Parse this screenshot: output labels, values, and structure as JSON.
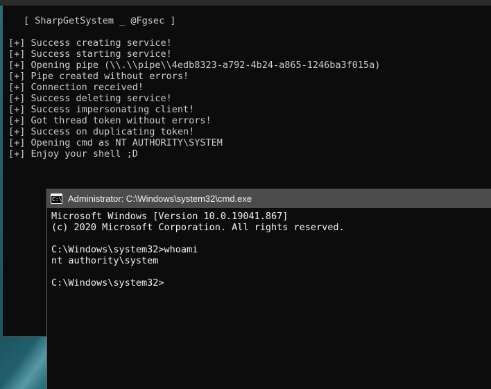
{
  "desktop": {
    "wallpaper_color": "#1d5563"
  },
  "top_strip": {
    "color": "#2b2b2c"
  },
  "sharp_window": {
    "name": "SharpGetSystem console",
    "background_color": "#0c0c0c",
    "text_color": "#cccccc",
    "banner": "[ SharpGetSystem _ @Fgsec ]",
    "lines": [
      "[+] Success creating service!",
      "[+] Success starting service!",
      "[+] Opening pipe (\\\\.\\\\pipe\\\\4edb8323-a792-4b24-a865-1246ba3f015a)",
      "[+] Pipe created without errors!",
      "[+] Connection received!",
      "[+] Success deleting service!",
      "[+] Success impersonating client!",
      "[+] Got thread token without errors!",
      "[+] Success on duplicating token!",
      "[+] Opening cmd as NT AUTHORITY\\SYSTEM",
      "[+] Enjoy your shell ;D"
    ]
  },
  "cmd_window": {
    "name": "Administrator cmd.exe",
    "titlebar_color": "#4c4c4c",
    "title": "Administrator: C:\\Windows\\system32\\cmd.exe",
    "icon": "console-icon",
    "icon_glyph": "C:\\_",
    "background_color": "#0c0c0c",
    "text_color": "#f2f2f2",
    "lines": [
      "Microsoft Windows [Version 10.0.19041.867]",
      "(c) 2020 Microsoft Corporation. All rights reserved.",
      "",
      "C:\\Windows\\system32>whoami",
      "nt authority\\system",
      "",
      "C:\\Windows\\system32>"
    ]
  }
}
